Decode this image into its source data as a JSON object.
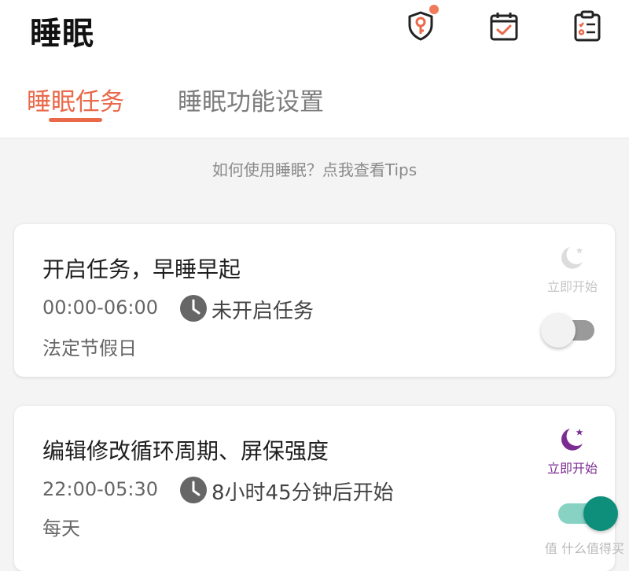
{
  "header": {
    "title": "睡眠",
    "icons": [
      "shield-key-icon",
      "calendar-check-icon",
      "clipboard-list-icon"
    ],
    "notification_dot": true
  },
  "tabs": [
    {
      "label": "睡眠任务",
      "active": true
    },
    {
      "label": "睡眠功能设置",
      "active": false
    }
  ],
  "tips": "如何使用睡眠？点我查看Tips",
  "tasks": [
    {
      "title": "开启任务，早睡早起",
      "time_range": "00:00-06:00",
      "status": "未开启任务",
      "repeat": "法定节假日",
      "start_label": "立即开始",
      "enabled": false
    },
    {
      "title": "编辑修改循环周期、屏保强度",
      "time_range": "22:00-05:30",
      "status": "8小时45分钟后开始",
      "repeat": "每天",
      "start_label": "立即开始",
      "enabled": true
    }
  ],
  "watermark": "值 什么值得买",
  "colors": {
    "accent": "#e9694a",
    "teal": "#0e8f7c",
    "purple": "#7b2c92"
  }
}
